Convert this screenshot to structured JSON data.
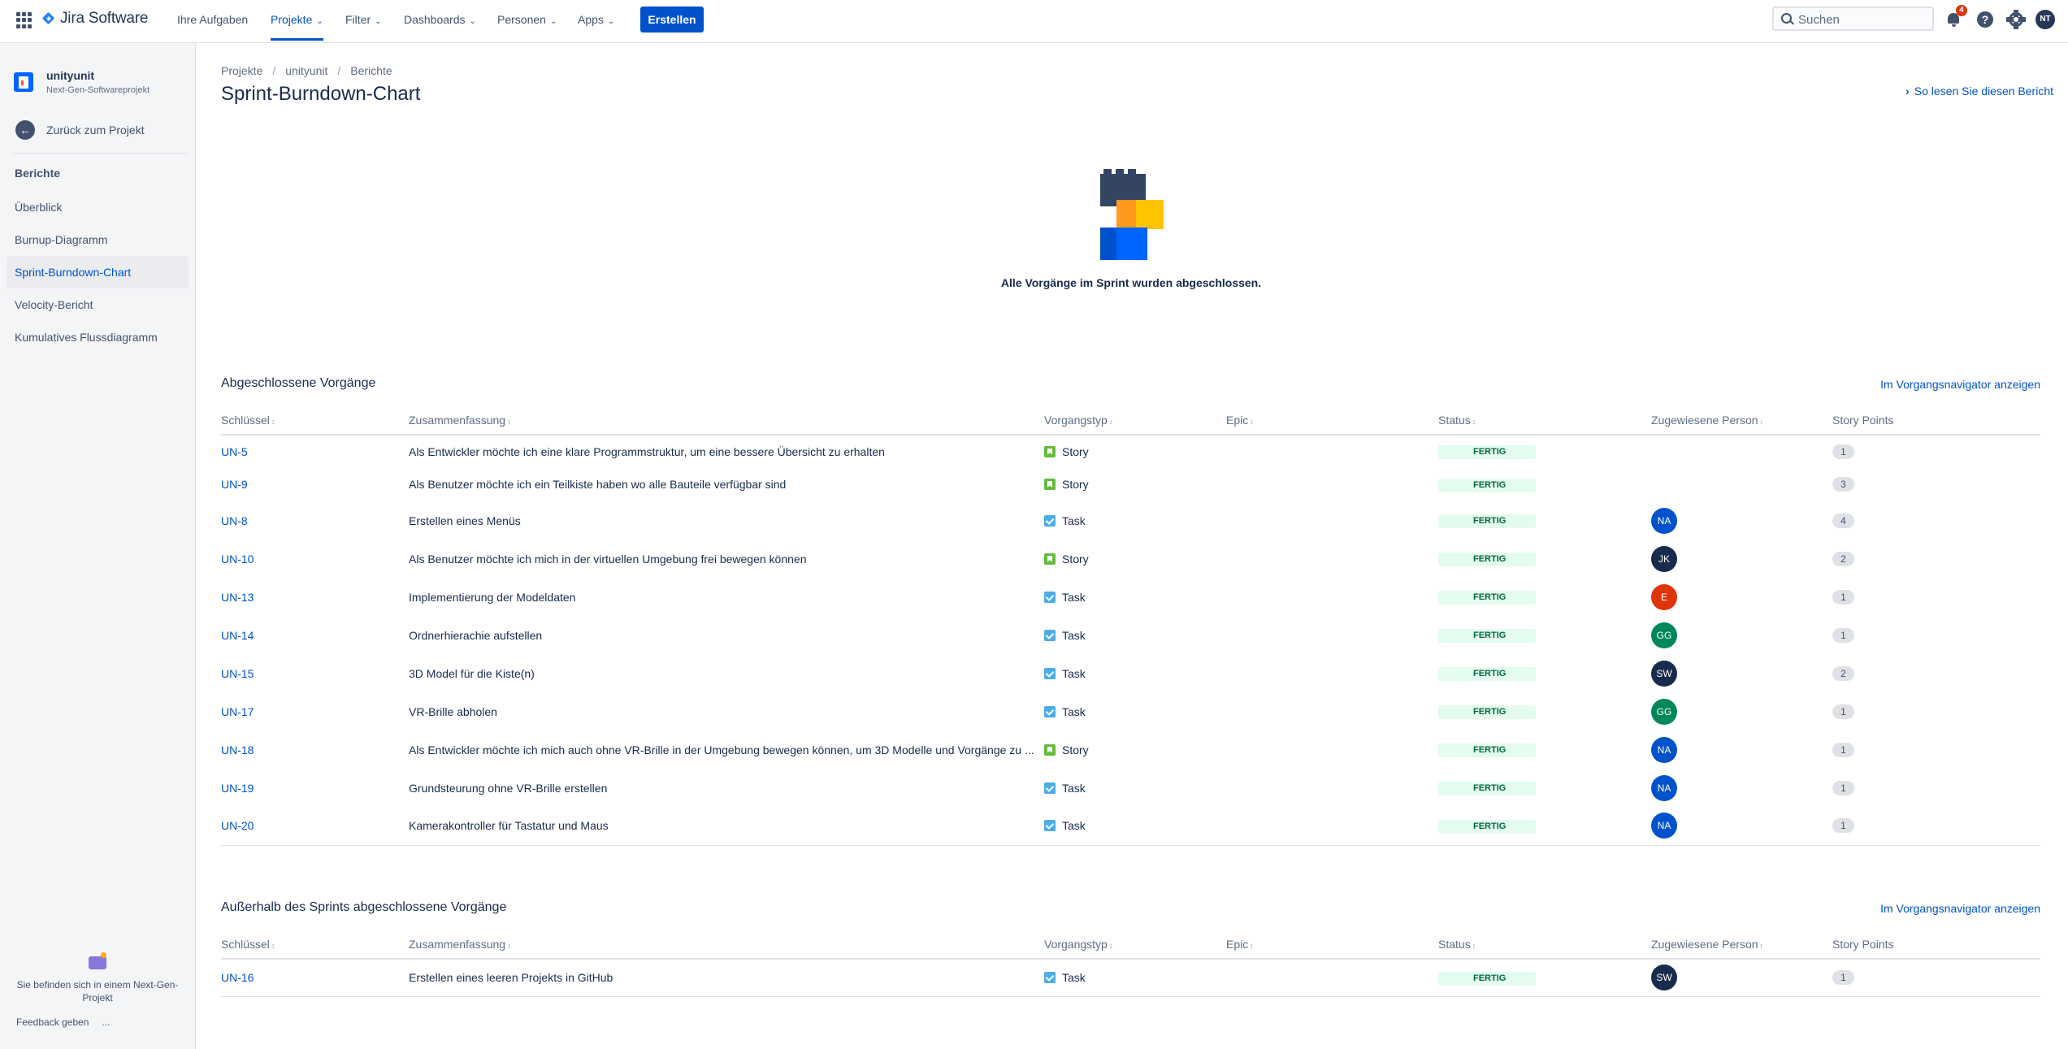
{
  "topnav": {
    "product": "Jira Software",
    "items": [
      {
        "label": "Ihre Aufgaben"
      },
      {
        "label": "Projekte"
      },
      {
        "label": "Filter"
      },
      {
        "label": "Dashboards"
      },
      {
        "label": "Personen"
      },
      {
        "label": "Apps"
      }
    ],
    "create_label": "Erstellen",
    "search_placeholder": "Suchen",
    "notification_count": "4",
    "user_initials": "NT"
  },
  "sidebar": {
    "project_name": "unityunit",
    "project_type": "Next-Gen-Softwareprojekt",
    "back_label": "Zurück zum Projekt",
    "section_label": "Berichte",
    "items": [
      {
        "label": "Überblick"
      },
      {
        "label": "Burnup-Diagramm"
      },
      {
        "label": "Sprint-Burndown-Chart"
      },
      {
        "label": "Velocity-Bericht"
      },
      {
        "label": "Kumulatives Flussdiagramm"
      }
    ],
    "nextgen_text": "Sie befinden sich in einem Next-Gen-Projekt",
    "feedback_label": "Feedback geben",
    "more_label": "..."
  },
  "breadcrumbs": [
    "Projekte",
    "unityunit",
    "Berichte"
  ],
  "page_title": "Sprint-Burndown-Chart",
  "howto_link": "So lesen Sie diesen Bericht",
  "completed_message": "Alle Vorgänge im Sprint wurden abgeschlossen.",
  "columns": [
    "Schlüssel",
    "Zusammenfassung",
    "Vorgangstyp",
    "Epic",
    "Status",
    "Zugewiesene Person",
    "Story Points"
  ],
  "sections": [
    {
      "title": "Abgeschlossene Vorgänge",
      "link": "Im Vorgangsnavigator anzeigen",
      "rows": [
        {
          "key": "UN-5",
          "summary": "Als Entwickler möchte ich eine klare Programmstruktur, um eine bessere Übersicht zu erhalten",
          "type": "Story",
          "epic": "",
          "status": "FERTIG",
          "assignee": "",
          "points": "1"
        },
        {
          "key": "UN-9",
          "summary": "Als Benutzer möchte ich ein Teilkiste haben wo alle Bauteile verfügbar sind",
          "type": "Story",
          "epic": "",
          "status": "FERTIG",
          "assignee": "",
          "points": "3"
        },
        {
          "key": "UN-8",
          "summary": "Erstellen eines Menüs",
          "type": "Task",
          "epic": "",
          "status": "FERTIG",
          "assignee": "NA",
          "points": "4"
        },
        {
          "key": "UN-10",
          "summary": "Als Benutzer möchte ich mich in der virtuellen Umgebung frei bewegen können",
          "type": "Story",
          "epic": "",
          "status": "FERTIG",
          "assignee": "JK",
          "points": "2"
        },
        {
          "key": "UN-13",
          "summary": "Implementierung der Modeldaten",
          "type": "Task",
          "epic": "",
          "status": "FERTIG",
          "assignee": "E",
          "points": "1"
        },
        {
          "key": "UN-14",
          "summary": "Ordnerhierachie aufstellen",
          "type": "Task",
          "epic": "",
          "status": "FERTIG",
          "assignee": "GG",
          "points": "1"
        },
        {
          "key": "UN-15",
          "summary": "3D Model für die Kiste(n)",
          "type": "Task",
          "epic": "",
          "status": "FERTIG",
          "assignee": "SW",
          "points": "2"
        },
        {
          "key": "UN-17",
          "summary": "VR-Brille abholen",
          "type": "Task",
          "epic": "",
          "status": "FERTIG",
          "assignee": "GG",
          "points": "1"
        },
        {
          "key": "UN-18",
          "summary": "Als Entwickler möchte ich mich auch ohne VR-Brille in der Umgebung bewegen können, um 3D Modelle und Vorgänge zu ...",
          "type": "Story",
          "epic": "",
          "status": "FERTIG",
          "assignee": "NA",
          "points": "1"
        },
        {
          "key": "UN-19",
          "summary": "Grundsteurung ohne VR-Brille erstellen",
          "type": "Task",
          "epic": "",
          "status": "FERTIG",
          "assignee": "NA",
          "points": "1"
        },
        {
          "key": "UN-20",
          "summary": "Kamerakontroller für Tastatur und Maus",
          "type": "Task",
          "epic": "",
          "status": "FERTIG",
          "assignee": "NA",
          "points": "1"
        }
      ]
    },
    {
      "title": "Außerhalb des Sprints abgeschlossene Vorgänge",
      "link": "Im Vorgangsnavigator anzeigen",
      "rows": [
        {
          "key": "UN-16",
          "summary": "Erstellen eines leeren Projekts in GitHub",
          "type": "Task",
          "epic": "",
          "status": "FERTIG",
          "assignee": "SW",
          "points": "1"
        }
      ]
    }
  ]
}
